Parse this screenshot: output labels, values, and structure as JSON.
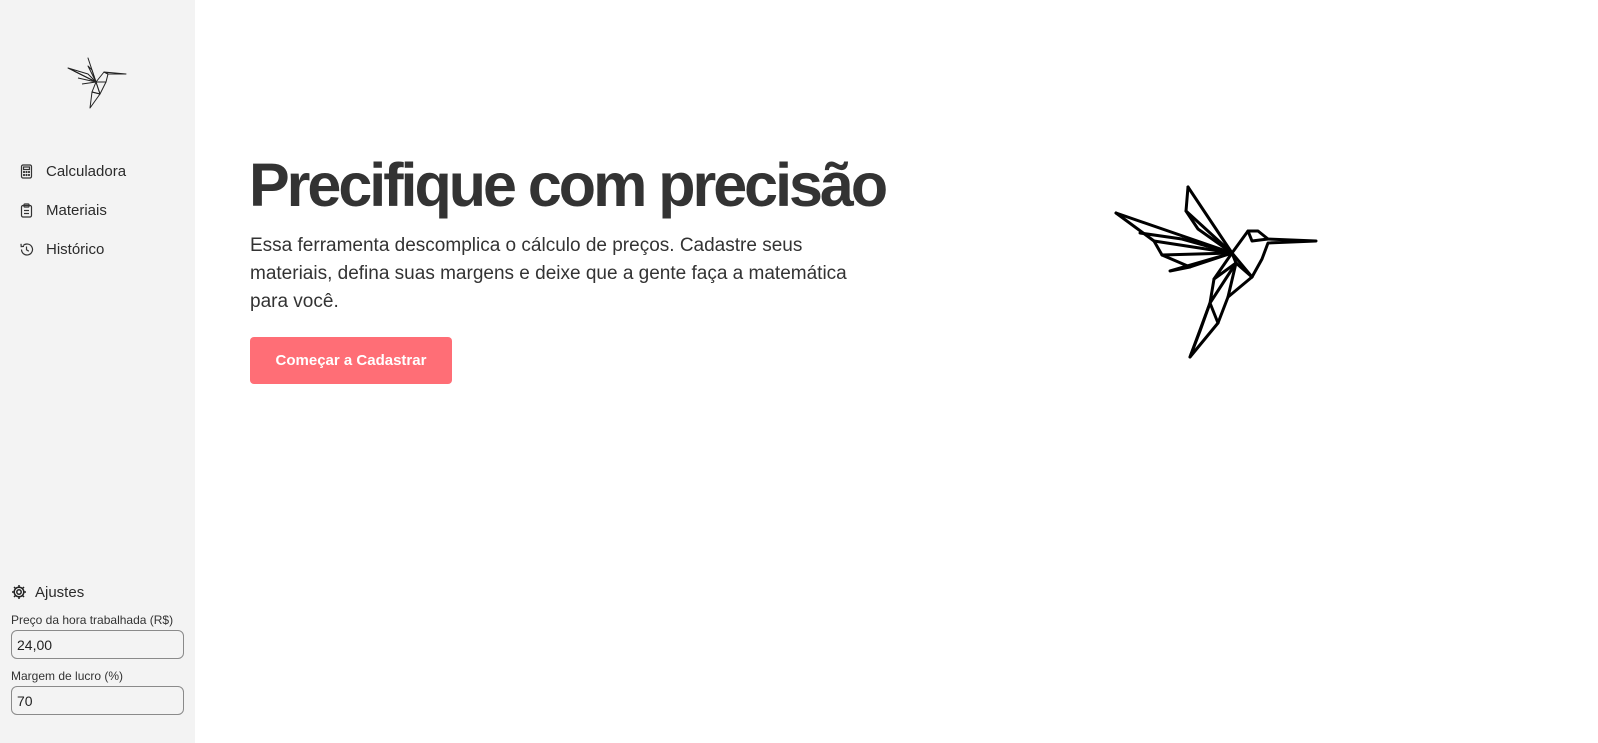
{
  "sidebar": {
    "logo_icon": "hummingbird-icon",
    "items": [
      {
        "label": "Calculadora",
        "icon": "calculator-icon"
      },
      {
        "label": "Materiais",
        "icon": "clipboard-icon"
      },
      {
        "label": "Histórico",
        "icon": "history-icon"
      }
    ],
    "settings": {
      "title": "Ajustes",
      "icon": "gear-icon",
      "hour_price_label": "Preço da hora trabalhada (R$)",
      "hour_price_value": "24,00",
      "margin_label": "Margem de lucro (%)",
      "margin_value": "70"
    }
  },
  "main": {
    "title": "Precifique com precisão",
    "description": "Essa ferramenta descomplica o cálculo de preços. Cadastre seus materiais, defina suas margens e deixe que a gente faça a matemática para você.",
    "cta_label": "Começar a Cadastrar",
    "illustration_icon": "hummingbird-icon"
  },
  "colors": {
    "sidebar_bg": "#f3f3f3",
    "accent": "#ff6e76",
    "text": "#333333"
  }
}
